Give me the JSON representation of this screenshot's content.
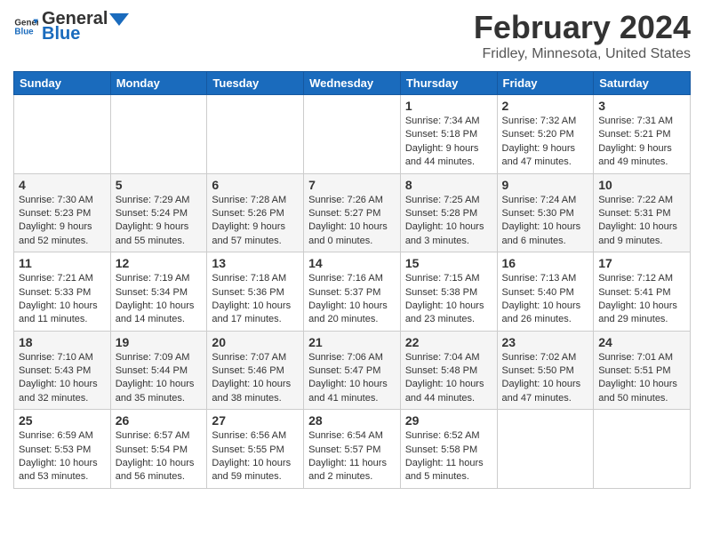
{
  "header": {
    "logo_general": "General",
    "logo_blue": "Blue",
    "month_year": "February 2024",
    "location": "Fridley, Minnesota, United States"
  },
  "days_of_week": [
    "Sunday",
    "Monday",
    "Tuesday",
    "Wednesday",
    "Thursday",
    "Friday",
    "Saturday"
  ],
  "weeks": [
    [
      {
        "day": "",
        "sunrise": "",
        "sunset": "",
        "daylight": ""
      },
      {
        "day": "",
        "sunrise": "",
        "sunset": "",
        "daylight": ""
      },
      {
        "day": "",
        "sunrise": "",
        "sunset": "",
        "daylight": ""
      },
      {
        "day": "",
        "sunrise": "",
        "sunset": "",
        "daylight": ""
      },
      {
        "day": "1",
        "sunrise": "Sunrise: 7:34 AM",
        "sunset": "Sunset: 5:18 PM",
        "daylight": "Daylight: 9 hours and 44 minutes."
      },
      {
        "day": "2",
        "sunrise": "Sunrise: 7:32 AM",
        "sunset": "Sunset: 5:20 PM",
        "daylight": "Daylight: 9 hours and 47 minutes."
      },
      {
        "day": "3",
        "sunrise": "Sunrise: 7:31 AM",
        "sunset": "Sunset: 5:21 PM",
        "daylight": "Daylight: 9 hours and 49 minutes."
      }
    ],
    [
      {
        "day": "4",
        "sunrise": "Sunrise: 7:30 AM",
        "sunset": "Sunset: 5:23 PM",
        "daylight": "Daylight: 9 hours and 52 minutes."
      },
      {
        "day": "5",
        "sunrise": "Sunrise: 7:29 AM",
        "sunset": "Sunset: 5:24 PM",
        "daylight": "Daylight: 9 hours and 55 minutes."
      },
      {
        "day": "6",
        "sunrise": "Sunrise: 7:28 AM",
        "sunset": "Sunset: 5:26 PM",
        "daylight": "Daylight: 9 hours and 57 minutes."
      },
      {
        "day": "7",
        "sunrise": "Sunrise: 7:26 AM",
        "sunset": "Sunset: 5:27 PM",
        "daylight": "Daylight: 10 hours and 0 minutes."
      },
      {
        "day": "8",
        "sunrise": "Sunrise: 7:25 AM",
        "sunset": "Sunset: 5:28 PM",
        "daylight": "Daylight: 10 hours and 3 minutes."
      },
      {
        "day": "9",
        "sunrise": "Sunrise: 7:24 AM",
        "sunset": "Sunset: 5:30 PM",
        "daylight": "Daylight: 10 hours and 6 minutes."
      },
      {
        "day": "10",
        "sunrise": "Sunrise: 7:22 AM",
        "sunset": "Sunset: 5:31 PM",
        "daylight": "Daylight: 10 hours and 9 minutes."
      }
    ],
    [
      {
        "day": "11",
        "sunrise": "Sunrise: 7:21 AM",
        "sunset": "Sunset: 5:33 PM",
        "daylight": "Daylight: 10 hours and 11 minutes."
      },
      {
        "day": "12",
        "sunrise": "Sunrise: 7:19 AM",
        "sunset": "Sunset: 5:34 PM",
        "daylight": "Daylight: 10 hours and 14 minutes."
      },
      {
        "day": "13",
        "sunrise": "Sunrise: 7:18 AM",
        "sunset": "Sunset: 5:36 PM",
        "daylight": "Daylight: 10 hours and 17 minutes."
      },
      {
        "day": "14",
        "sunrise": "Sunrise: 7:16 AM",
        "sunset": "Sunset: 5:37 PM",
        "daylight": "Daylight: 10 hours and 20 minutes."
      },
      {
        "day": "15",
        "sunrise": "Sunrise: 7:15 AM",
        "sunset": "Sunset: 5:38 PM",
        "daylight": "Daylight: 10 hours and 23 minutes."
      },
      {
        "day": "16",
        "sunrise": "Sunrise: 7:13 AM",
        "sunset": "Sunset: 5:40 PM",
        "daylight": "Daylight: 10 hours and 26 minutes."
      },
      {
        "day": "17",
        "sunrise": "Sunrise: 7:12 AM",
        "sunset": "Sunset: 5:41 PM",
        "daylight": "Daylight: 10 hours and 29 minutes."
      }
    ],
    [
      {
        "day": "18",
        "sunrise": "Sunrise: 7:10 AM",
        "sunset": "Sunset: 5:43 PM",
        "daylight": "Daylight: 10 hours and 32 minutes."
      },
      {
        "day": "19",
        "sunrise": "Sunrise: 7:09 AM",
        "sunset": "Sunset: 5:44 PM",
        "daylight": "Daylight: 10 hours and 35 minutes."
      },
      {
        "day": "20",
        "sunrise": "Sunrise: 7:07 AM",
        "sunset": "Sunset: 5:46 PM",
        "daylight": "Daylight: 10 hours and 38 minutes."
      },
      {
        "day": "21",
        "sunrise": "Sunrise: 7:06 AM",
        "sunset": "Sunset: 5:47 PM",
        "daylight": "Daylight: 10 hours and 41 minutes."
      },
      {
        "day": "22",
        "sunrise": "Sunrise: 7:04 AM",
        "sunset": "Sunset: 5:48 PM",
        "daylight": "Daylight: 10 hours and 44 minutes."
      },
      {
        "day": "23",
        "sunrise": "Sunrise: 7:02 AM",
        "sunset": "Sunset: 5:50 PM",
        "daylight": "Daylight: 10 hours and 47 minutes."
      },
      {
        "day": "24",
        "sunrise": "Sunrise: 7:01 AM",
        "sunset": "Sunset: 5:51 PM",
        "daylight": "Daylight: 10 hours and 50 minutes."
      }
    ],
    [
      {
        "day": "25",
        "sunrise": "Sunrise: 6:59 AM",
        "sunset": "Sunset: 5:53 PM",
        "daylight": "Daylight: 10 hours and 53 minutes."
      },
      {
        "day": "26",
        "sunrise": "Sunrise: 6:57 AM",
        "sunset": "Sunset: 5:54 PM",
        "daylight": "Daylight: 10 hours and 56 minutes."
      },
      {
        "day": "27",
        "sunrise": "Sunrise: 6:56 AM",
        "sunset": "Sunset: 5:55 PM",
        "daylight": "Daylight: 10 hours and 59 minutes."
      },
      {
        "day": "28",
        "sunrise": "Sunrise: 6:54 AM",
        "sunset": "Sunset: 5:57 PM",
        "daylight": "Daylight: 11 hours and 2 minutes."
      },
      {
        "day": "29",
        "sunrise": "Sunrise: 6:52 AM",
        "sunset": "Sunset: 5:58 PM",
        "daylight": "Daylight: 11 hours and 5 minutes."
      },
      {
        "day": "",
        "sunrise": "",
        "sunset": "",
        "daylight": ""
      },
      {
        "day": "",
        "sunrise": "",
        "sunset": "",
        "daylight": ""
      }
    ]
  ]
}
